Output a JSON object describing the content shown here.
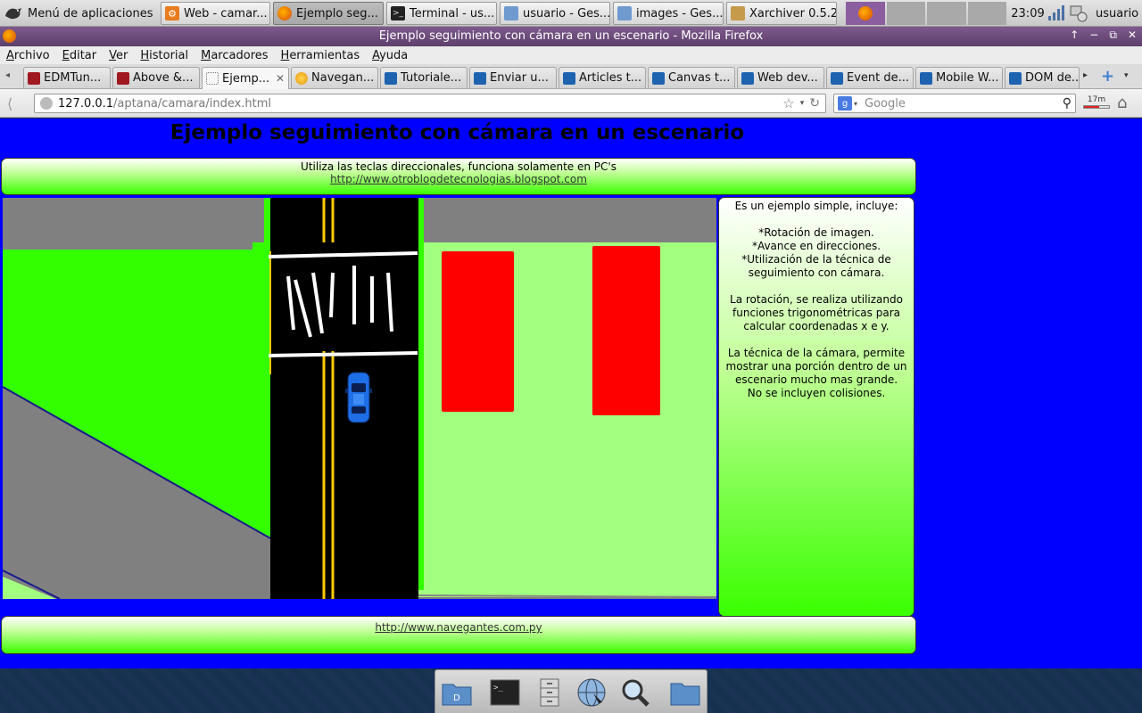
{
  "top_panel": {
    "app_menu": "Menú de aplicaciones",
    "tasks": [
      {
        "label": "Web - camar...",
        "icon": "web-icon"
      },
      {
        "label": "Ejemplo seg...",
        "icon": "firefox-icon"
      },
      {
        "label": "Terminal - us...",
        "icon": "terminal-icon"
      },
      {
        "label": "usuario - Ges...",
        "icon": "home-folder-icon"
      },
      {
        "label": "images - Ges...",
        "icon": "folder-icon"
      },
      {
        "label": "Xarchiver 0.5.2",
        "icon": "archive-icon"
      }
    ],
    "clock": "23:09",
    "user": "usuario"
  },
  "window": {
    "title": "Ejemplo seguimiento con cámara en un escenario - Mozilla Firefox"
  },
  "menubar": [
    "Archivo",
    "Editar",
    "Ver",
    "Historial",
    "Marcadores",
    "Herramientas",
    "Ayuda"
  ],
  "tabs": [
    "EDMTun...",
    "Above &...",
    "Ejemp...",
    "Navegan...",
    "Tutoriale...",
    "Enviar u...",
    "Articles t...",
    "Canvas t...",
    "Web dev...",
    "Event de...",
    "Mobile W...",
    "DOM de..."
  ],
  "navbar": {
    "url_host": "127.0.0.1",
    "url_path": "/aptana/camara/index.html",
    "search_placeholder": "Google",
    "download_label": "17m"
  },
  "page": {
    "heading": "Ejemplo seguimiento con cámara en un escenario",
    "intro_text": "Utiliza las teclas direccionales, funciona solamente en PC's",
    "intro_link": "http://www.otroblogdetecnologias.blogspot.com",
    "side_lines": [
      "Es un ejemplo simple, incluye:",
      "",
      "*Rotación de imagen.",
      "*Avance en direcciones.",
      "*Utilización de la técnica de",
      "seguimiento con cámara.",
      "",
      "La rotación, se realiza utilizando",
      "funciones trigonométricas para",
      "calcular coordenadas x e y.",
      "",
      "La técnica de la cámara, permite",
      "mostrar una porción dentro de un",
      "escenario mucho mas grande.",
      "No se incluyen colisiones."
    ],
    "footer_link": "http://www.navegantes.com.py"
  },
  "colors": {
    "page_bg": "#0000ff",
    "grass": "#33ff00",
    "light_grass": "#a3ff7f",
    "road": "#000000",
    "road_line": "#ffcc00",
    "building": "#ff0000",
    "car": "#1e6ee6"
  },
  "dock": [
    "files-icon",
    "terminal-icon",
    "cabinet-icon",
    "browser-icon",
    "search-icon",
    "folder-icon"
  ]
}
